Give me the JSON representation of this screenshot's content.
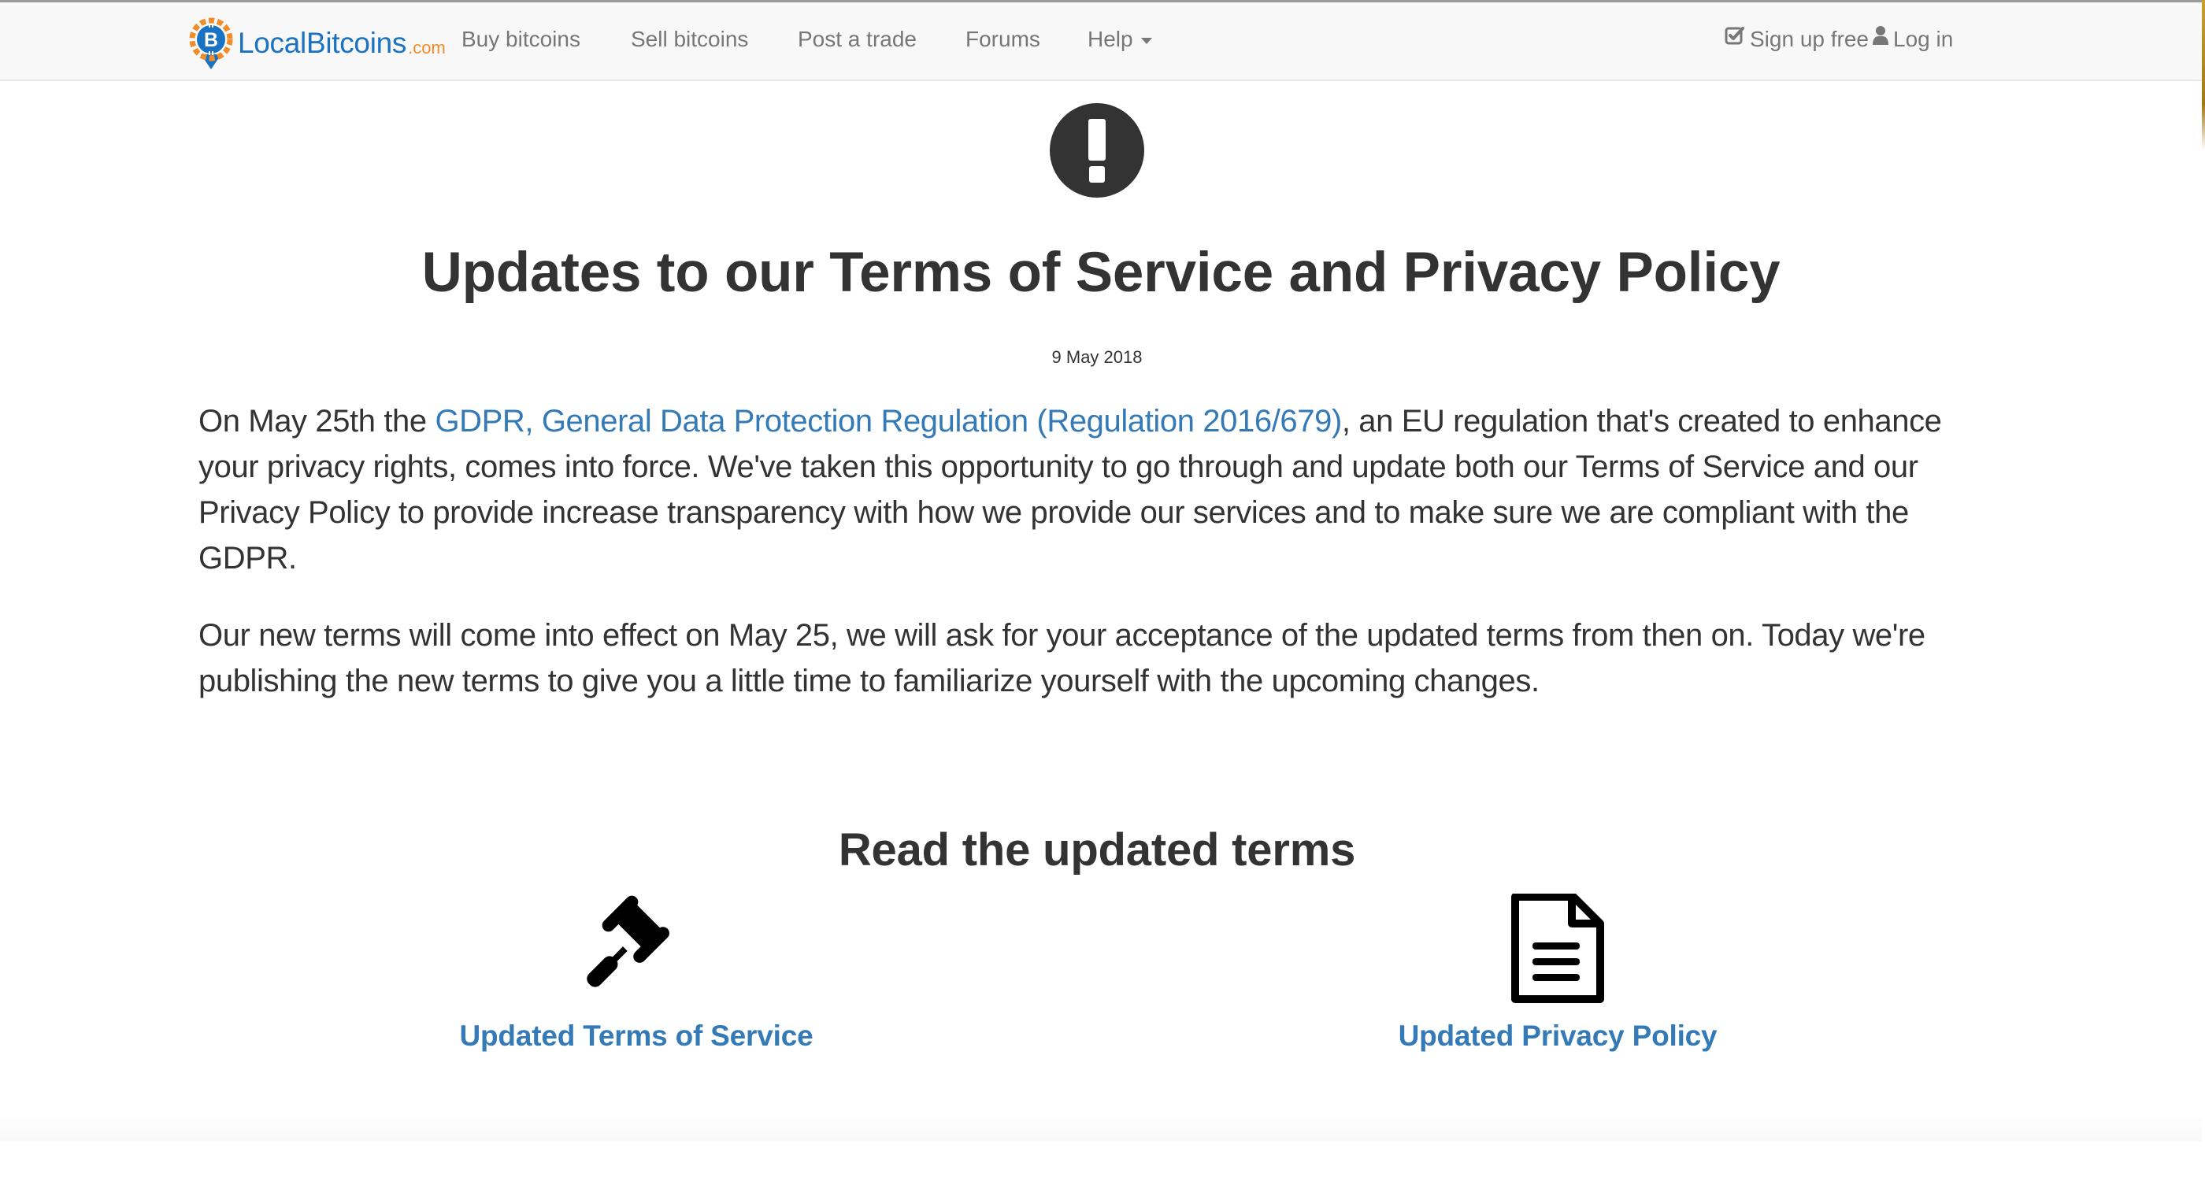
{
  "brand": {
    "name": "LocalBitcoins",
    "suffix": ".com",
    "colors": {
      "blue": "#1a72c2",
      "orange": "#f28c28"
    }
  },
  "nav": {
    "items": [
      {
        "label": "Buy bitcoins"
      },
      {
        "label": "Sell bitcoins"
      },
      {
        "label": "Post a trade"
      },
      {
        "label": "Forums"
      },
      {
        "label": "Help",
        "icon": "caret-down-icon"
      }
    ],
    "right": [
      {
        "label": "Sign up free",
        "icon": "check-square-icon"
      },
      {
        "label": "Log in",
        "icon": "user-icon"
      }
    ]
  },
  "main": {
    "icon": "exclamation-circle-icon",
    "title": "Updates to our Terms of Service and Privacy Policy",
    "date": "9 May 2018",
    "paragraph1": {
      "before": "On May 25th the ",
      "link": "GDPR, General Data Protection Regulation (Regulation 2016/679)",
      "after": ", an EU regulation that's created to enhance your privacy rights, comes into force. We've taken this opportunity to go through and update both our Terms of Service and our Privacy Policy to provide increase transparency with how we provide our services and to make sure we are compliant with the GDPR."
    },
    "paragraph2": "Our new terms will come into effect on May 25, we will ask for your acceptance of the updated terms from then on. Today we're publishing the new terms to give you a little time to familiarize yourself with the upcoming changes.",
    "section_title": "Read the updated terms",
    "documents": [
      {
        "label": "Updated Terms of Service",
        "icon": "gavel-icon"
      },
      {
        "label": "Updated Privacy Policy",
        "icon": "file-text-icon"
      }
    ]
  },
  "colors": {
    "link": "#337ab7",
    "text": "#333333",
    "nav_text": "#777777",
    "navbar_bg": "#f8f8f8"
  }
}
